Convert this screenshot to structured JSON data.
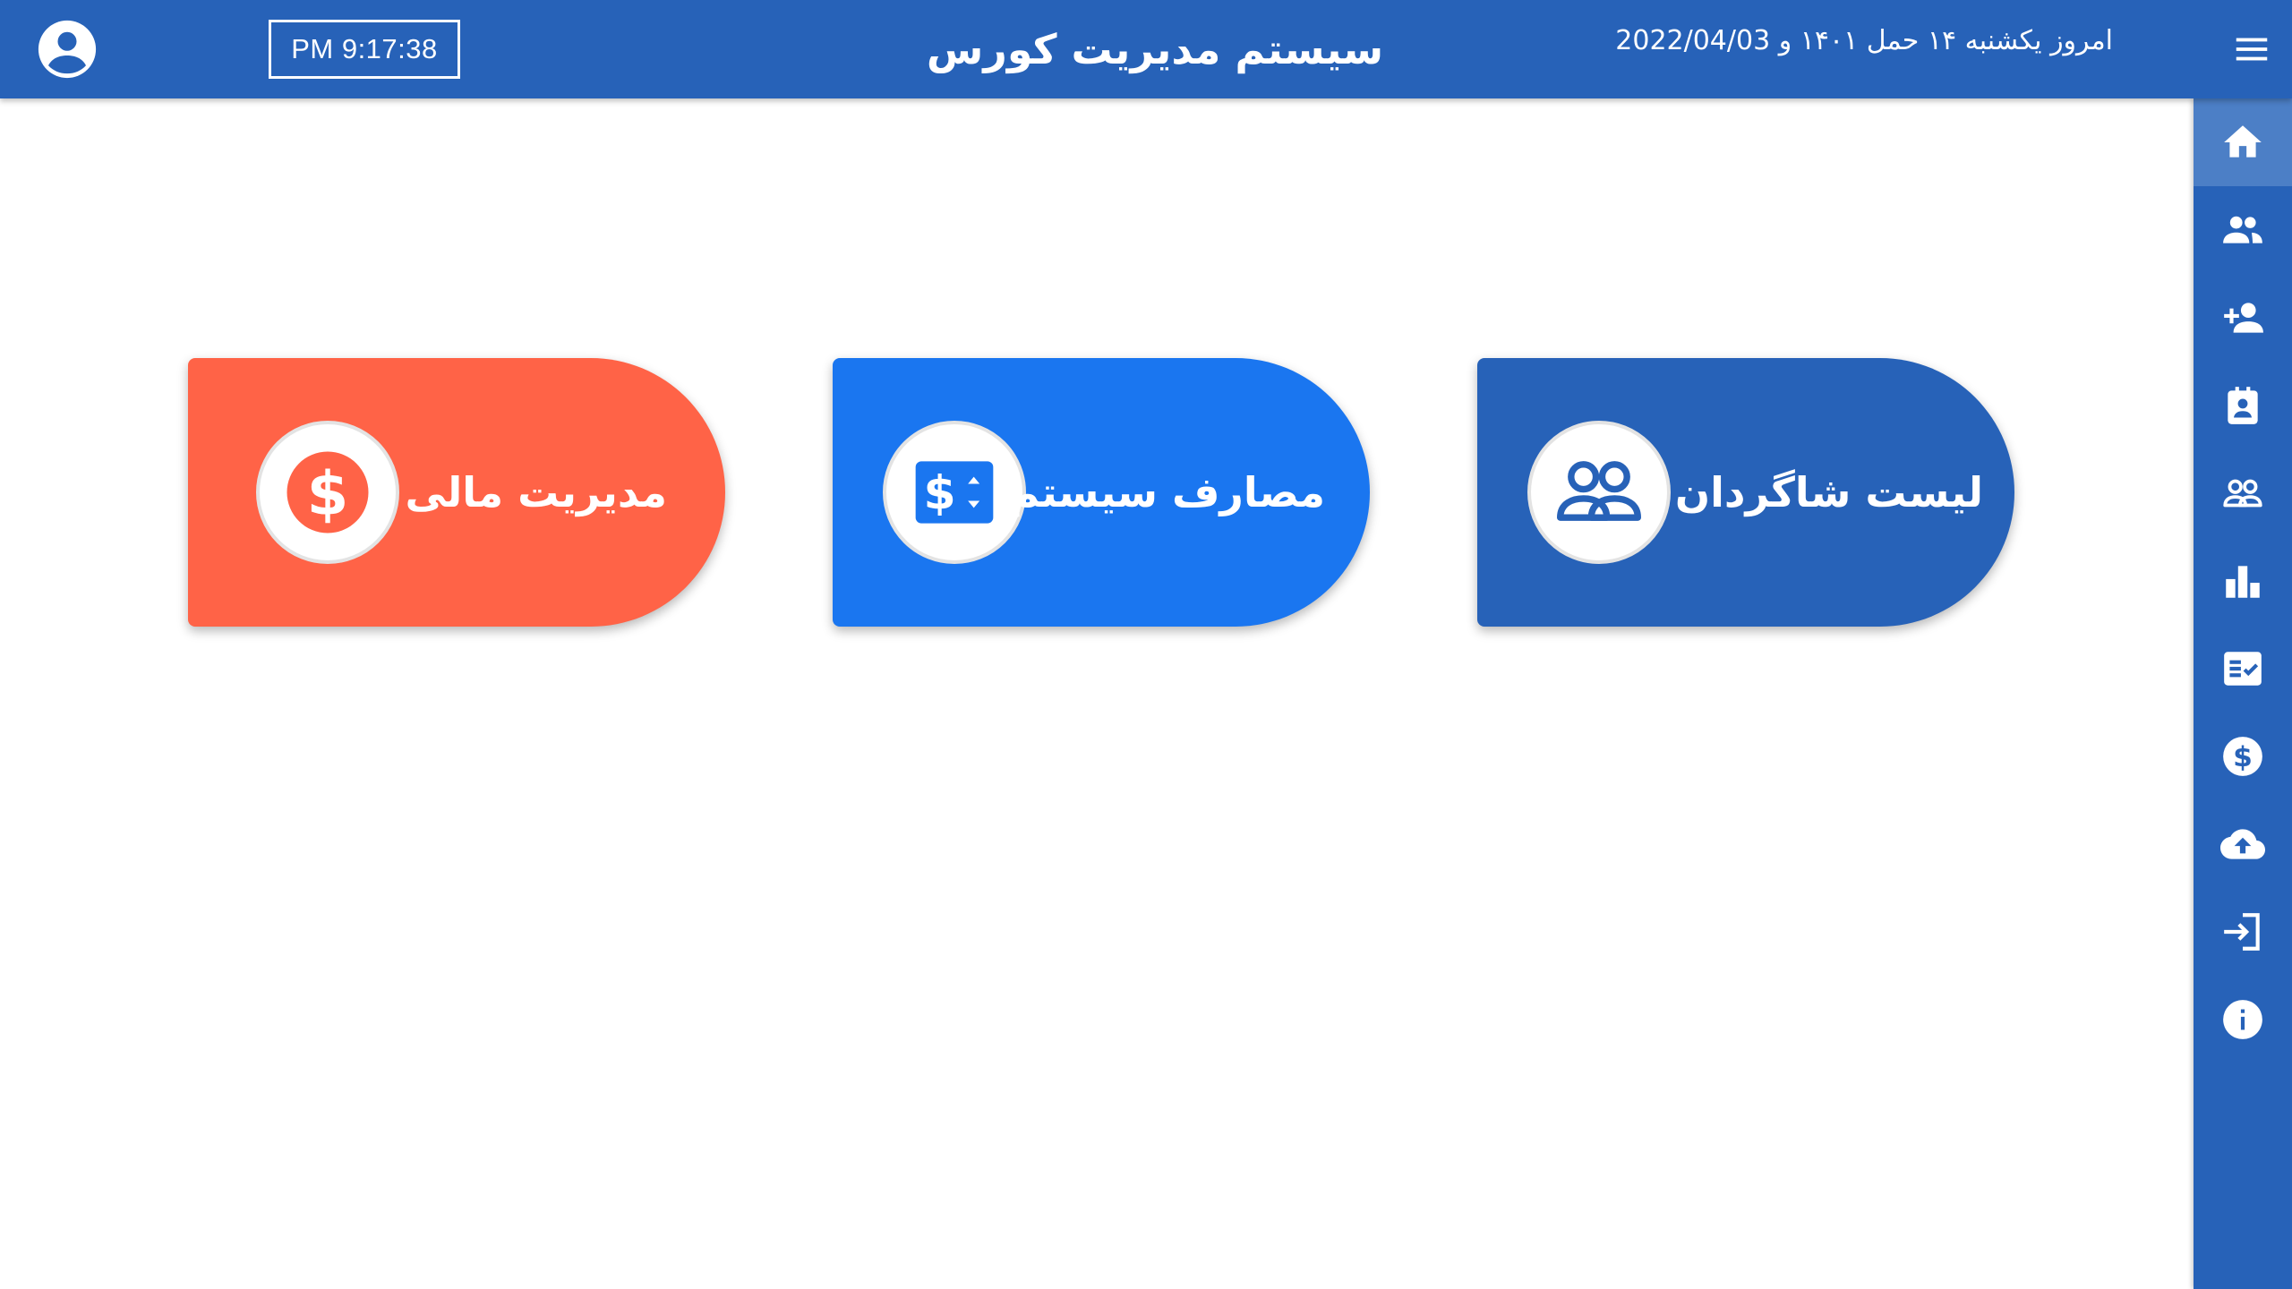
{
  "header": {
    "clock": "PM 9:17:38",
    "title": "سیستم مدیریت کورس",
    "date": "امروز یکشنبه ۱۴ حمل ۱۴۰۱ و 2022/04/03",
    "icons": {
      "user": "account-circle-icon",
      "menu": "hamburger-menu-icon"
    }
  },
  "sidebar": {
    "items": [
      {
        "icon": "home-icon",
        "active": true
      },
      {
        "icon": "people-icon",
        "active": false
      },
      {
        "icon": "person-add-icon",
        "active": false
      },
      {
        "icon": "badge-icon",
        "active": false
      },
      {
        "icon": "people-outline-icon",
        "active": false
      },
      {
        "icon": "bar-chart-icon",
        "active": false
      },
      {
        "icon": "fact-check-icon",
        "active": false
      },
      {
        "icon": "dollar-circle-icon",
        "active": false
      },
      {
        "icon": "cloud-upload-icon",
        "active": false
      },
      {
        "icon": "login-icon",
        "active": false
      },
      {
        "icon": "info-icon",
        "active": false
      }
    ]
  },
  "cards": [
    {
      "label": "لیست شاگردان",
      "icon": "people-outline-icon",
      "color": "#2762b8"
    },
    {
      "label": "مصارف سیستم",
      "icon": "price-change-icon",
      "color": "#1a76f0"
    },
    {
      "label": "مدیریت مالی",
      "icon": "dollar-circle-icon",
      "color": "#ff6347"
    }
  ],
  "colors": {
    "primary": "#2762b8",
    "sidebar_active": "#4c7fc6",
    "blue_card": "#1a76f0",
    "orange_card": "#ff6347",
    "background": "#ffffff"
  }
}
